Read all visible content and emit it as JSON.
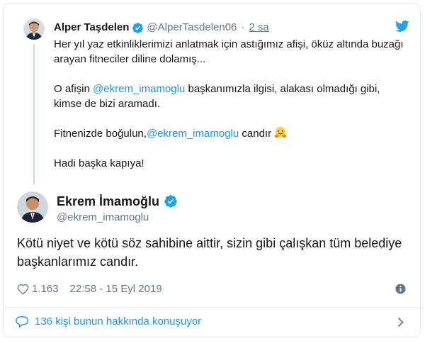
{
  "parent_tweet": {
    "name": "Alper Taşdelen",
    "handle": "@AlperTasdelen06",
    "separator": "·",
    "time": "2 sa",
    "paragraphs": [
      {
        "text": "Her yıl yaz etkinliklerimizi anlatmak için astığımız afişi, öküz altında buzağı arayan fitneciler diline dolamış..."
      }
    ],
    "p2_before": "O afişin ",
    "p2_mention": "@ekrem_imamoglu",
    "p2_after": " başkanımızla ilgisi, alakası olmadığı gibi, kimse de bizi aramadı.",
    "p3_before": "Fitnenizde boğulun,",
    "p3_mention": "@ekrem_imamoglu",
    "p3_after": " candır",
    "p4": "Hadi başka kapıya!"
  },
  "main_tweet": {
    "name": "Ekrem İmamoğlu",
    "handle": "@ekrem_imamoglu",
    "text": "Kötü niyet ve kötü söz sahibine aittir, sizin gibi çalışkan tüm belediye başkanlarımız candır.",
    "likes": "1.163",
    "timestamp": "22:58 - 15 Eyl 2019"
  },
  "footer": {
    "talking": "136 kişi bunun hakkında konuşuyor"
  },
  "colors": {
    "link": "#1b95e0",
    "muted": "#657786",
    "verified": "#1da1f2"
  },
  "icons": [
    "verified-icon",
    "twitter-bird-icon",
    "hugging-face-icon",
    "heart-icon",
    "info-icon",
    "speech-bubble-icon",
    "chevron-right-icon"
  ]
}
